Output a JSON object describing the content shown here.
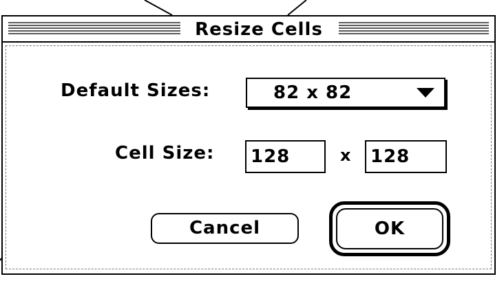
{
  "dialog": {
    "title": "Resize Cells",
    "default_sizes_label": "Default Sizes:",
    "default_sizes_value": "82 x 82",
    "cell_size_label": "Cell Size:",
    "cell_width": "128",
    "cell_height": "128",
    "times_symbol": "x",
    "cancel_label": "Cancel",
    "ok_label": "OK"
  },
  "icons": {
    "popup_arrow": "triangle-down-icon"
  },
  "colors": {
    "foreground": "#000000",
    "background": "#ffffff"
  }
}
